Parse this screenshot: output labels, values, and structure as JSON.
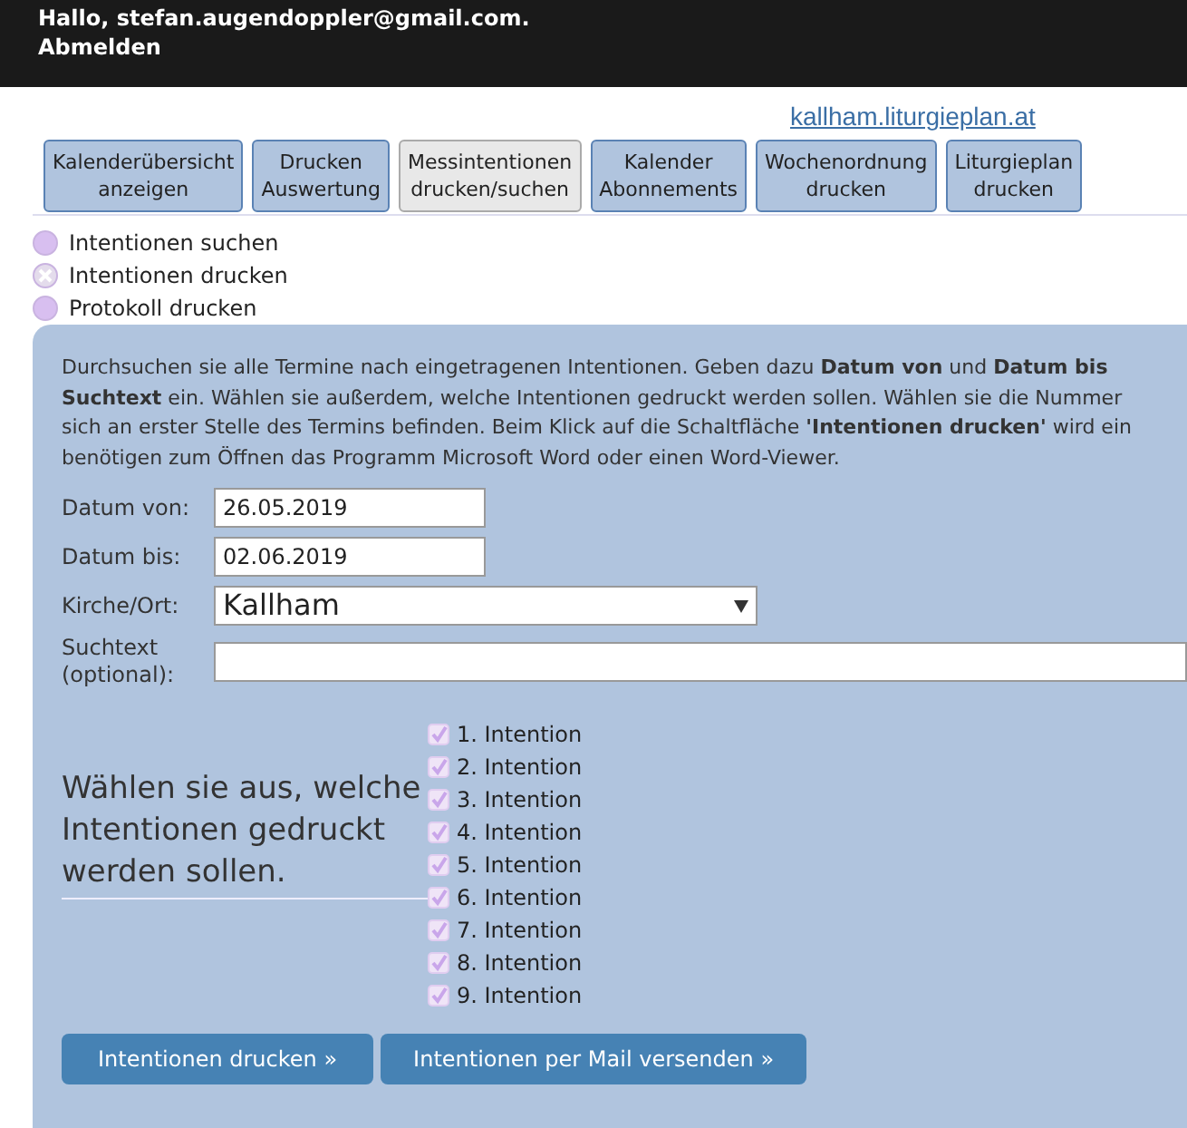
{
  "header": {
    "greeting": "Hallo, stefan.augendoppler@gmail.com.",
    "logout": "Abmelden"
  },
  "site_link": "kallham.liturgieplan.at",
  "tabs": [
    {
      "lines": [
        "Kalenderübersicht",
        "anzeigen"
      ],
      "selected": false
    },
    {
      "lines": [
        "Drucken",
        "Auswertung"
      ],
      "selected": false
    },
    {
      "lines": [
        "Messintentionen",
        "drucken/suchen"
      ],
      "selected": true
    },
    {
      "lines": [
        "Kalender",
        "Abonnements"
      ],
      "selected": false
    },
    {
      "lines": [
        "Wochenordnung",
        "drucken"
      ],
      "selected": false
    },
    {
      "lines": [
        "Liturgieplan",
        "drucken"
      ],
      "selected": false
    }
  ],
  "modes": [
    {
      "label": "Intentionen suchen",
      "selected": false
    },
    {
      "label": "Intentionen drucken",
      "selected": true
    },
    {
      "label": "Protokoll drucken",
      "selected": false
    }
  ],
  "description": [
    "Durchsuchen sie alle Termine nach eingetragenen Intentionen. Geben dazu **Datum von** und **Datum bis**",
    "**Suchtext** ein. Wählen sie außerdem, welche Intentionen gedruckt werden sollen. Wählen sie die Nummer",
    "sich an erster Stelle des Termins befinden. Beim Klick auf die Schaltfläche **'Intentionen drucken'** wird ein",
    "benötigen zum Öffnen das Programm Microsoft Word oder einen Word-Viewer."
  ],
  "fields": [
    {
      "kind": "text",
      "label": "Datum von:",
      "value": "26.05.2019"
    },
    {
      "kind": "text",
      "label": "Datum bis:",
      "value": "02.06.2019"
    },
    {
      "kind": "select",
      "label": "Kirche/Ort:",
      "value": "Kallham"
    },
    {
      "kind": "wide",
      "label": "Suchtext (optional):"
    }
  ],
  "choose_prompt": "Wählen sie aus, welche Intentionen gedruckt werden sollen.",
  "intentions": [
    {
      "label": "1. Intention",
      "checked": true
    },
    {
      "label": "2. Intention",
      "checked": true
    },
    {
      "label": "3. Intention",
      "checked": true
    },
    {
      "label": "4. Intention",
      "checked": true
    },
    {
      "label": "5. Intention",
      "checked": true
    },
    {
      "label": "6. Intention",
      "checked": true
    },
    {
      "label": "7. Intention",
      "checked": true
    },
    {
      "label": "8. Intention",
      "checked": true
    },
    {
      "label": "9. Intention",
      "checked": true
    }
  ],
  "buttons": [
    "Intentionen drucken »",
    "Intentionen per Mail versenden »"
  ]
}
